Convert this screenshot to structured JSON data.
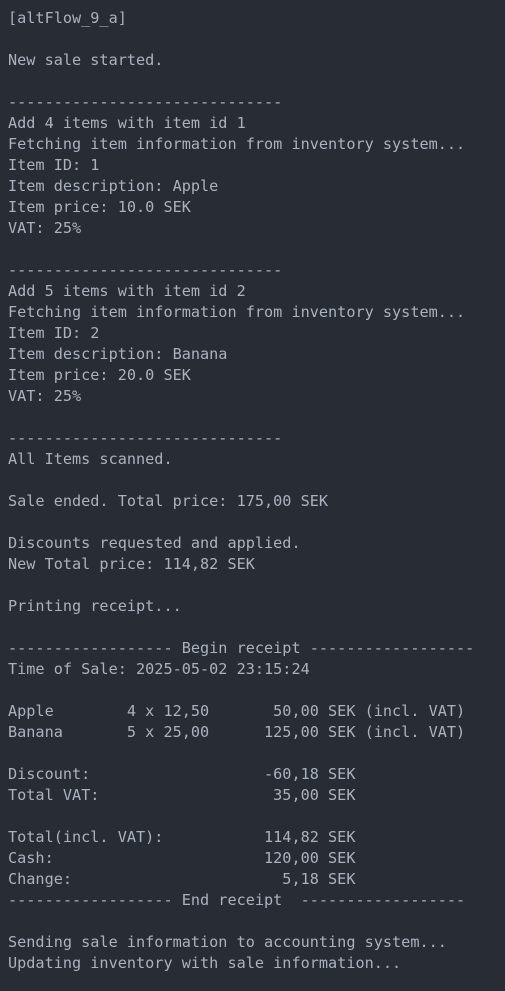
{
  "console": {
    "lines": [
      "[altFlow_9_a]",
      "",
      "New sale started.",
      "",
      "------------------------------",
      "Add 4 items with item id 1",
      "Fetching item information from inventory system...",
      "Item ID: 1",
      "Item description: Apple",
      "Item price: 10.0 SEK",
      "VAT: 25%",
      "",
      "------------------------------",
      "Add 5 items with item id 2",
      "Fetching item information from inventory system...",
      "Item ID: 2",
      "Item description: Banana",
      "Item price: 20.0 SEK",
      "VAT: 25%",
      "",
      "------------------------------",
      "All Items scanned.",
      "",
      "Sale ended. Total price: 175,00 SEK",
      "",
      "Discounts requested and applied.",
      "New Total price: 114,82 SEK",
      "",
      "Printing receipt...",
      "",
      "------------------ Begin receipt ------------------",
      "Time of Sale: 2025-05-02 23:15:24",
      "",
      "Apple        4 x 12,50       50,00 SEK (incl. VAT)",
      "Banana       5 x 25,00      125,00 SEK (incl. VAT)",
      "",
      "Discount:                   -60,18 SEK",
      "Total VAT:                   35,00 SEK",
      "",
      "Total(incl. VAT):           114,82 SEK",
      "Cash:                       120,00 SEK",
      "Change:                       5,18 SEK",
      "------------------ End receipt  ------------------",
      "",
      "Sending sale information to accounting system...",
      "Updating inventory with sale information..."
    ]
  }
}
